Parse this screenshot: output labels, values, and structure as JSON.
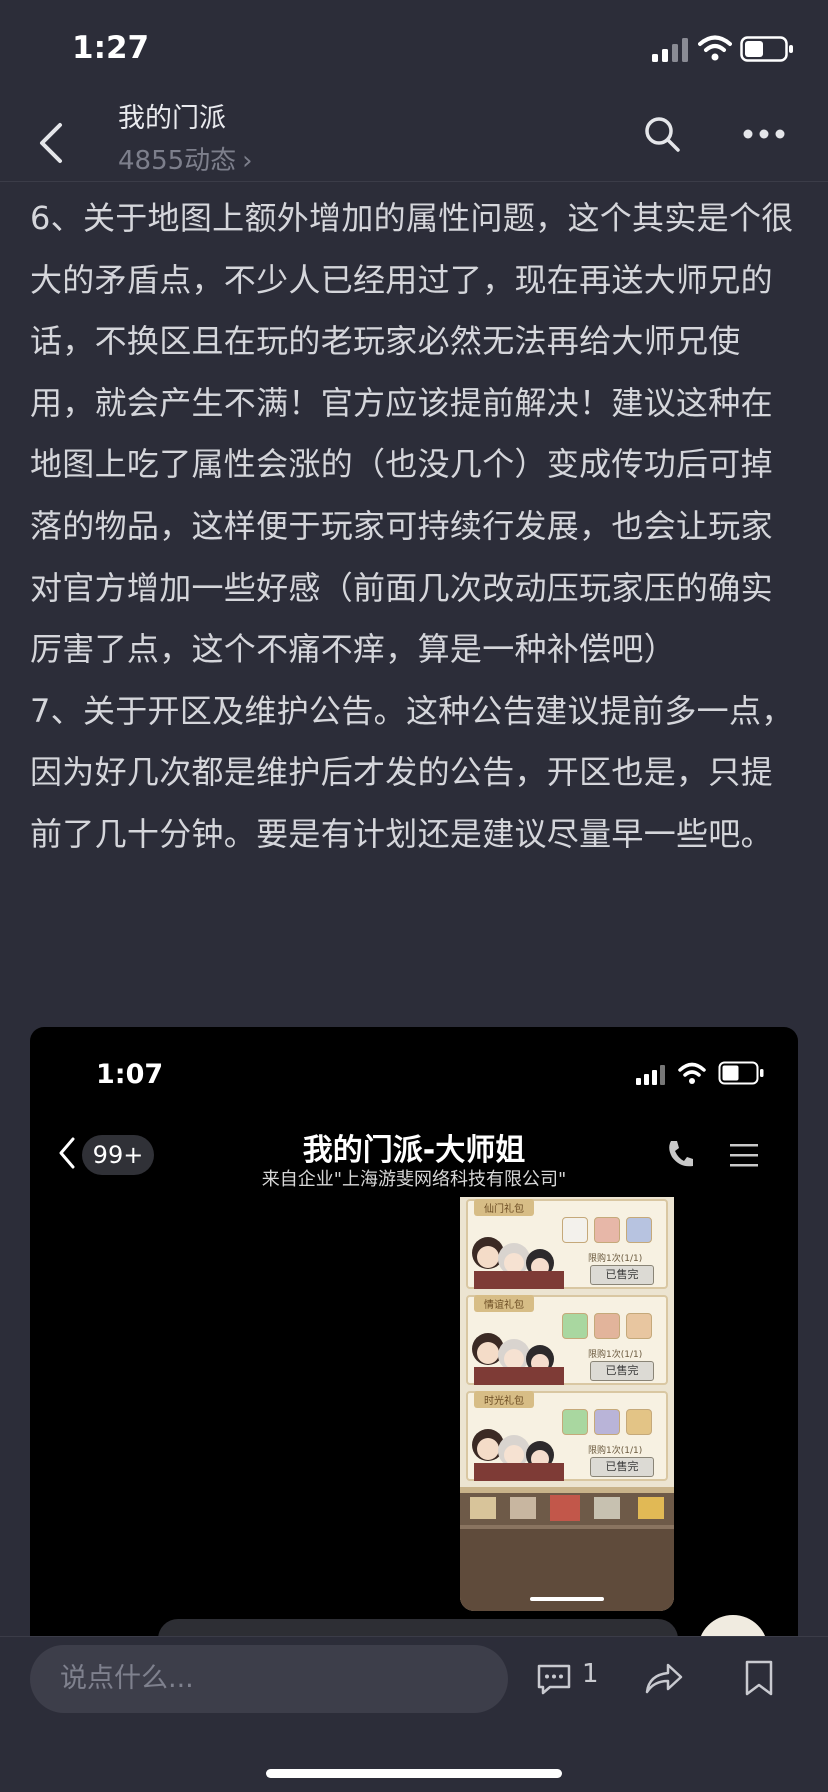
{
  "status_bar": {
    "time": "1:27"
  },
  "header": {
    "title": "我的门派",
    "subtitle": "4855动态",
    "subtitle_chevron": "›"
  },
  "article": {
    "paragraphs": [
      "6、关于地图上额外增加的属性问题，这个其实是个很大的矛盾点，不少人已经用过了，现在再送大师兄的话，不换区且在玩的老玩家必然无法再给大师兄使用，就会产生不满！官方应该提前解决！建议这种在地图上吃了属性会涨的（也没几个）变成传功后可掉落的物品，这样便于玩家可持续行发展，也会让玩家对官方增加一些好感（前面几次改动压玩家压的确实厉害了点，这个不痛不痒，算是一种补偿吧）",
      "7、关于开区及维护公告。这种公告建议提前多一点，因为好几次都是维护后才发的公告，开区也是，只提前了几十分钟。要是有计划还是建议尽量早一些吧。"
    ]
  },
  "embedded_screenshot": {
    "time": "1:07",
    "unread_badge": "99+",
    "chat_title": "我的门派-大师姐",
    "chat_subtitle": "来自企业\"上海游斐网络科技有限公司\"",
    "packs": [
      {
        "label": "仙门礼包",
        "limit": "限购1次(1/1)",
        "status": "已售完"
      },
      {
        "label": "情谊礼包",
        "limit": "限购1次(1/1)",
        "status": "已售完"
      },
      {
        "label": "时光礼包",
        "limit": "限购1次(1/1)",
        "status": "已售完"
      }
    ]
  },
  "bottom_bar": {
    "comment_placeholder": "说点什么...",
    "comment_count": "1"
  },
  "colors": {
    "background": "#2c2d39",
    "text": "#d5d6db",
    "muted": "#7d7f8c",
    "input_bg": "#3d3e4a"
  }
}
